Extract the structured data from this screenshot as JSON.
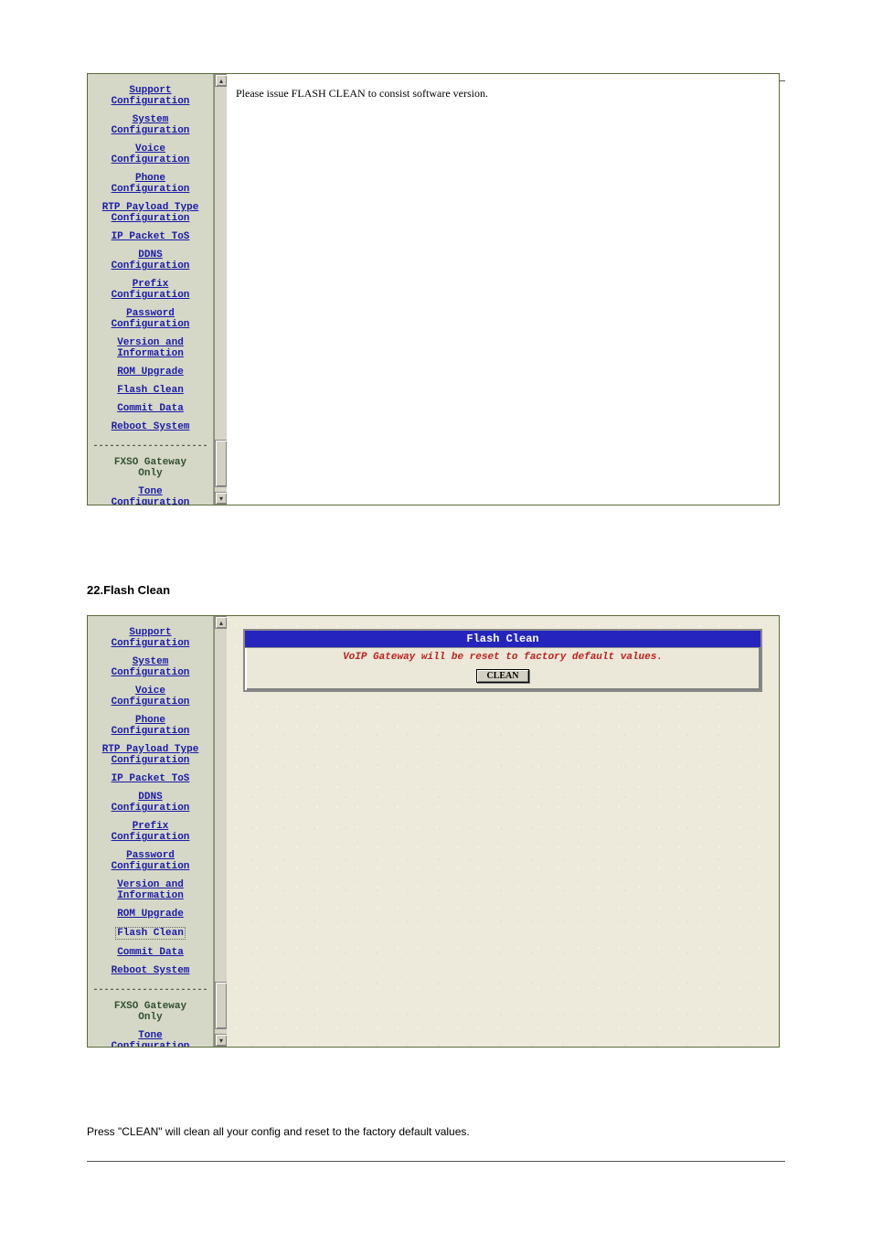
{
  "nav": {
    "support": {
      "l1": "Support",
      "l2": "Configuration"
    },
    "system": {
      "l1": "System",
      "l2": "Configuration"
    },
    "voice": {
      "l1": "Voice",
      "l2": "Configuration"
    },
    "phone": {
      "l1": "Phone",
      "l2": "Configuration"
    },
    "rtp": {
      "l1": "RTP Payload Type",
      "l2": "Configuration"
    },
    "tos": {
      "l1": "IP Packet ToS"
    },
    "ddns": {
      "l1": "DDNS",
      "l2": "Configuration"
    },
    "prefix": {
      "l1": "Prefix",
      "l2": "Configuration"
    },
    "password": {
      "l1": "Password",
      "l2": "Configuration"
    },
    "version": {
      "l1": "Version and",
      "l2": "Information"
    },
    "rom": {
      "l1": "ROM Upgrade"
    },
    "flash": {
      "l1": "Flash Clean"
    },
    "commit": {
      "l1": "Commit Data"
    },
    "reboot": {
      "l1": "Reboot System"
    },
    "separator": "---------------------",
    "fxso": {
      "l1": "FXSO Gateway",
      "l2": "Only"
    },
    "tone": {
      "l1": "Tone",
      "l2": "Configuration"
    }
  },
  "shot1": {
    "message": "Please issue FLASH CLEAN to consist software version."
  },
  "shot2": {
    "panel_title": "Flash Clean",
    "panel_warn": "VoIP Gateway will be reset to factory default values.",
    "clean_button": "CLEAN"
  },
  "captions": {
    "c1": "22.Flash Clean",
    "c2": "Press \"CLEAN\" will clean all your config and reset to the factory default values."
  }
}
